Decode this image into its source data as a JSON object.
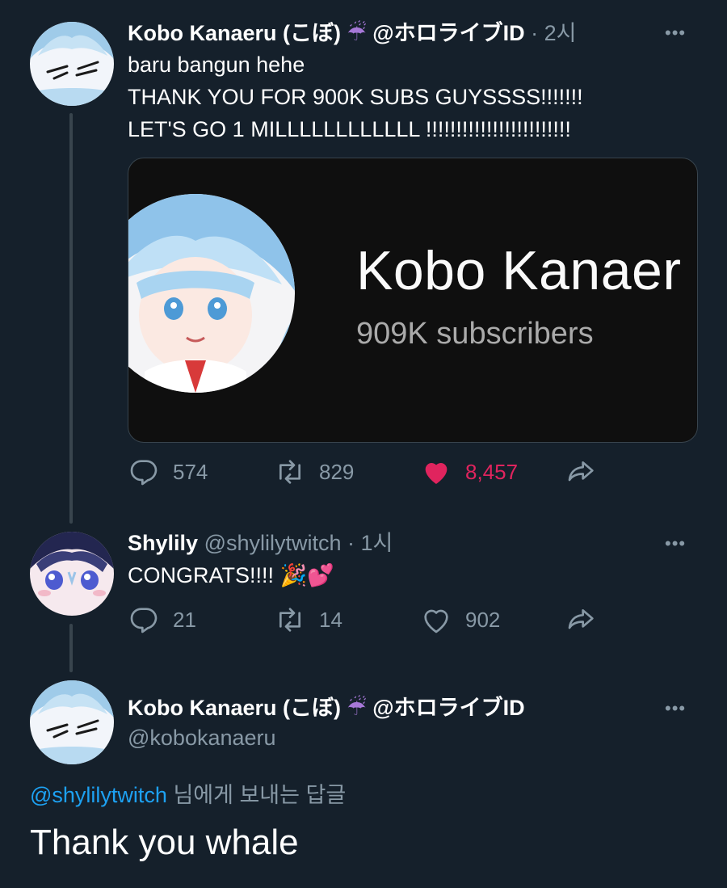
{
  "tweet": {
    "author_name": "Kobo Kanaeru (こぼ)",
    "author_emoji": "☔",
    "author_affil": "@ホロライブID",
    "time": "· 2시",
    "more": "•••",
    "lines": [
      "baru bangun hehe",
      "THANK YOU FOR 900K SUBS GUYSSSS!!!!!!!",
      "LET'S GO 1 MILLLLLLLLLLLL !!!!!!!!!!!!!!!!!!!!!!!!"
    ],
    "card": {
      "channel_name": "Kobo Kanaer",
      "subscribers": "909K subscribers"
    },
    "actions": {
      "replies": "574",
      "retweets": "829",
      "likes": "8,457"
    }
  },
  "reply": {
    "author_name": "Shylily",
    "handle": "@shylilytwitch",
    "time": "· 1시",
    "more": "•••",
    "text": "CONGRATS!!!! 🎉💕",
    "actions": {
      "replies": "21",
      "retweets": "14",
      "likes": "902"
    }
  },
  "focused": {
    "author_name": "Kobo Kanaeru (こぼ)",
    "author_emoji": "☔",
    "author_affil": "@ホロライブID",
    "handle": "@kobokanaeru",
    "more": "•••",
    "replying_to_handle": "@shylilytwitch",
    "replying_to_suffix": " 님에게 보내는 답글",
    "text": "Thank you whale"
  },
  "colors": {
    "background": "#15202b",
    "muted": "#8899a6",
    "link": "#1da1f2",
    "like": "#e0245e",
    "divider": "#38444d"
  }
}
